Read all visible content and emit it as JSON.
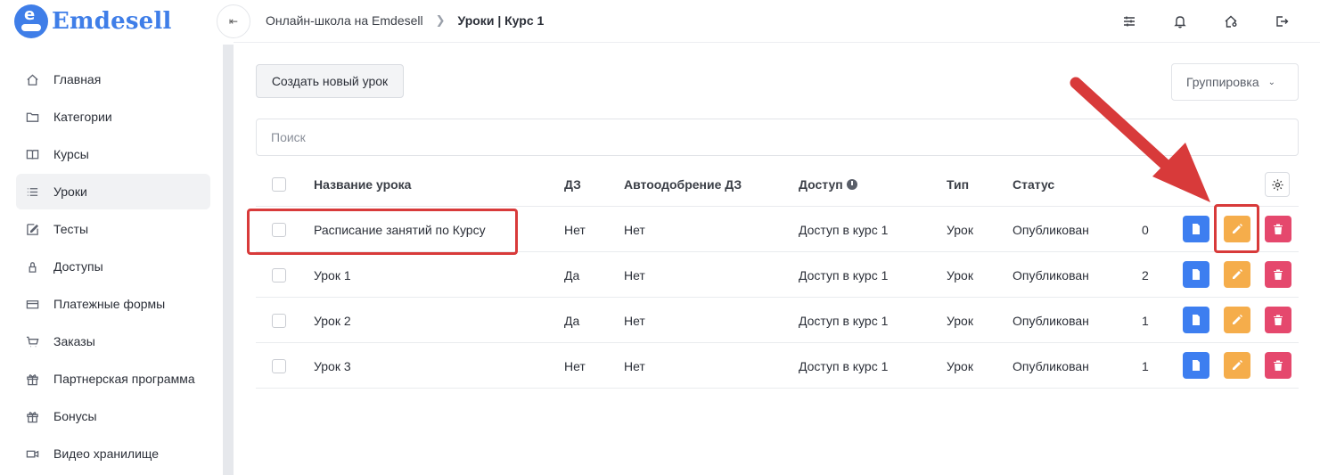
{
  "app": {
    "logo_text": "Emdesell"
  },
  "sidebar": {
    "items": [
      {
        "label": "Главная",
        "icon": "home-icon"
      },
      {
        "label": "Категории",
        "icon": "folder-icon"
      },
      {
        "label": "Курсы",
        "icon": "book-icon"
      },
      {
        "label": "Уроки",
        "icon": "list-icon",
        "active": true
      },
      {
        "label": "Тесты",
        "icon": "edit-icon"
      },
      {
        "label": "Доступы",
        "icon": "lock-icon"
      },
      {
        "label": "Платежные формы",
        "icon": "credit-card-icon"
      },
      {
        "label": "Заказы",
        "icon": "cart-icon"
      },
      {
        "label": "Партнерская программа",
        "icon": "gift-icon"
      },
      {
        "label": "Бонусы",
        "icon": "gift-icon"
      },
      {
        "label": "Видео хранилище",
        "icon": "video-icon"
      }
    ]
  },
  "header": {
    "breadcrumb": [
      "Онлайн-школа на Emdesell",
      "Уроки | Курс 1"
    ],
    "icons": [
      "sliders-icon",
      "bell-icon",
      "home-settings-icon",
      "logout-icon"
    ]
  },
  "toolbar": {
    "create_label": "Создать новый урок",
    "group_label": "Группировка"
  },
  "search": {
    "placeholder": "Поиск"
  },
  "table": {
    "headers": {
      "name": "Название урока",
      "hw": "ДЗ",
      "auto": "Автоодобрение ДЗ",
      "access": "Доступ",
      "type": "Тип",
      "status": "Статус"
    },
    "rows": [
      {
        "name": "Расписание занятий по Курсу",
        "hw": "Нет",
        "auto": "Нет",
        "access": "Доступ в курс 1",
        "type": "Урок",
        "status": "Опубликован",
        "num": "0"
      },
      {
        "name": "Урок 1",
        "hw": "Да",
        "auto": "Нет",
        "access": "Доступ в курс 1",
        "type": "Урок",
        "status": "Опубликован",
        "num": "2"
      },
      {
        "name": "Урок 2",
        "hw": "Да",
        "auto": "Нет",
        "access": "Доступ в курс 1",
        "type": "Урок",
        "status": "Опубликован",
        "num": "1"
      },
      {
        "name": "Урок 3",
        "hw": "Нет",
        "auto": "Нет",
        "access": "Доступ в курс 1",
        "type": "Урок",
        "status": "Опубликован",
        "num": "1"
      }
    ]
  },
  "colors": {
    "brand": "#3f7ee8",
    "view": "#3d7ef0",
    "edit": "#f5ad4b",
    "delete": "#e5486d",
    "annotation": "#d83a3a"
  }
}
